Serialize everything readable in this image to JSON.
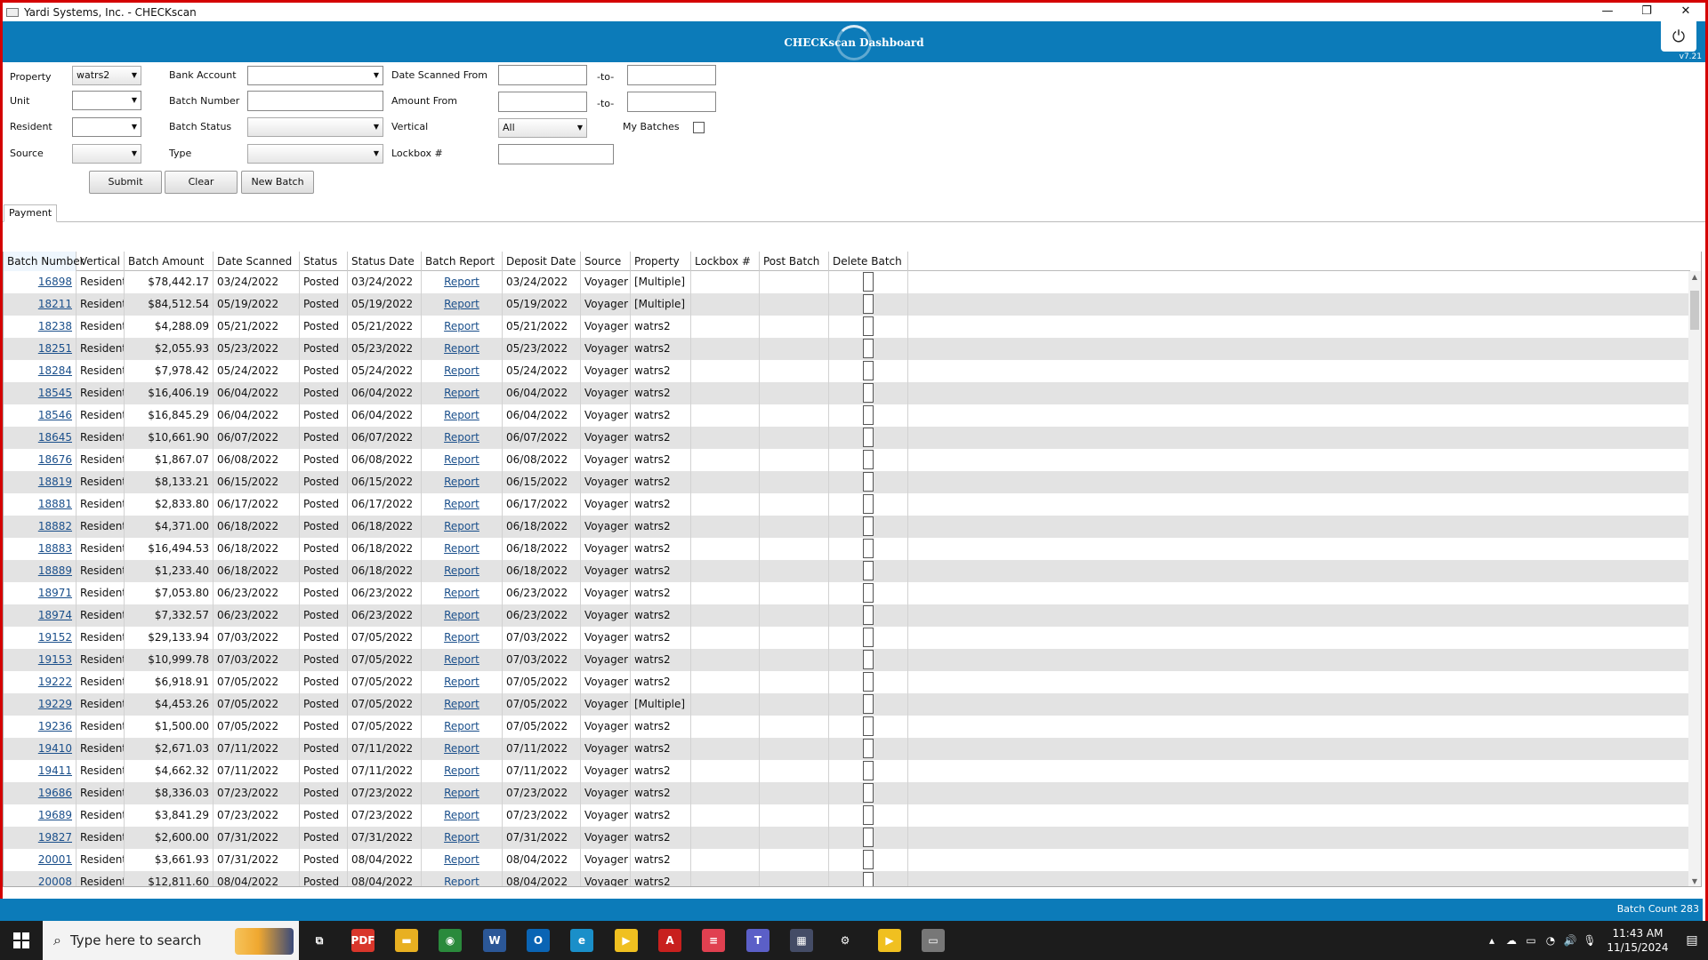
{
  "window": {
    "title": "Yardi Systems, Inc. - CHECKscan",
    "minimize": "—",
    "restore": "❐",
    "close": "✕"
  },
  "header": {
    "title": "CHECKscan Dashboard",
    "version": "v7.21",
    "power_glyph": "⏻"
  },
  "filters": {
    "property_label": "Property",
    "property_value": "watrs2",
    "unit_label": "Unit",
    "resident_label": "Resident",
    "source_label": "Source",
    "bank_account_label": "Bank Account",
    "batch_number_label": "Batch Number",
    "batch_status_label": "Batch Status",
    "type_label": "Type",
    "date_scanned_from_label": "Date Scanned From",
    "amount_from_label": "Amount From",
    "vertical_label": "Vertical",
    "vertical_value": "All",
    "lockbox_label": "Lockbox #",
    "to_label_1": "-to-",
    "to_label_2": "-to-",
    "my_batches_label": "My Batches",
    "submit_label": "Submit",
    "clear_label": "Clear",
    "new_batch_label": "New Batch"
  },
  "tabs": {
    "payment": "Payment"
  },
  "grid": {
    "columns": [
      "Batch Number",
      "Vertical",
      "Batch Amount",
      "Date Scanned",
      "Status",
      "Status Date",
      "Batch Report",
      "Deposit Date",
      "Source",
      "Property",
      "Lockbox #",
      "Post Batch",
      "Delete Batch"
    ],
    "rows": [
      [
        "16898",
        "Residential",
        "$78,442.17",
        "03/24/2022",
        "Posted",
        "03/24/2022",
        "Report",
        "03/24/2022",
        "Voyager",
        "[Multiple]"
      ],
      [
        "18211",
        "Residential",
        "$84,512.54",
        "05/19/2022",
        "Posted",
        "05/19/2022",
        "Report",
        "05/19/2022",
        "Voyager",
        "[Multiple]"
      ],
      [
        "18238",
        "Residential",
        "$4,288.09",
        "05/21/2022",
        "Posted",
        "05/21/2022",
        "Report",
        "05/21/2022",
        "Voyager",
        "watrs2"
      ],
      [
        "18251",
        "Residential",
        "$2,055.93",
        "05/23/2022",
        "Posted",
        "05/23/2022",
        "Report",
        "05/23/2022",
        "Voyager",
        "watrs2"
      ],
      [
        "18284",
        "Residential",
        "$7,978.42",
        "05/24/2022",
        "Posted",
        "05/24/2022",
        "Report",
        "05/24/2022",
        "Voyager",
        "watrs2"
      ],
      [
        "18545",
        "Residential",
        "$16,406.19",
        "06/04/2022",
        "Posted",
        "06/04/2022",
        "Report",
        "06/04/2022",
        "Voyager",
        "watrs2"
      ],
      [
        "18546",
        "Residential",
        "$16,845.29",
        "06/04/2022",
        "Posted",
        "06/04/2022",
        "Report",
        "06/04/2022",
        "Voyager",
        "watrs2"
      ],
      [
        "18645",
        "Residential",
        "$10,661.90",
        "06/07/2022",
        "Posted",
        "06/07/2022",
        "Report",
        "06/07/2022",
        "Voyager",
        "watrs2"
      ],
      [
        "18676",
        "Residential",
        "$1,867.07",
        "06/08/2022",
        "Posted",
        "06/08/2022",
        "Report",
        "06/08/2022",
        "Voyager",
        "watrs2"
      ],
      [
        "18819",
        "Residential",
        "$8,133.21",
        "06/15/2022",
        "Posted",
        "06/15/2022",
        "Report",
        "06/15/2022",
        "Voyager",
        "watrs2"
      ],
      [
        "18881",
        "Residential",
        "$2,833.80",
        "06/17/2022",
        "Posted",
        "06/17/2022",
        "Report",
        "06/17/2022",
        "Voyager",
        "watrs2"
      ],
      [
        "18882",
        "Residential",
        "$4,371.00",
        "06/18/2022",
        "Posted",
        "06/18/2022",
        "Report",
        "06/18/2022",
        "Voyager",
        "watrs2"
      ],
      [
        "18883",
        "Residential",
        "$16,494.53",
        "06/18/2022",
        "Posted",
        "06/18/2022",
        "Report",
        "06/18/2022",
        "Voyager",
        "watrs2"
      ],
      [
        "18889",
        "Residential",
        "$1,233.40",
        "06/18/2022",
        "Posted",
        "06/18/2022",
        "Report",
        "06/18/2022",
        "Voyager",
        "watrs2"
      ],
      [
        "18971",
        "Residential",
        "$7,053.80",
        "06/23/2022",
        "Posted",
        "06/23/2022",
        "Report",
        "06/23/2022",
        "Voyager",
        "watrs2"
      ],
      [
        "18974",
        "Residential",
        "$7,332.57",
        "06/23/2022",
        "Posted",
        "06/23/2022",
        "Report",
        "06/23/2022",
        "Voyager",
        "watrs2"
      ],
      [
        "19152",
        "Residential",
        "$29,133.94",
        "07/03/2022",
        "Posted",
        "07/05/2022",
        "Report",
        "07/03/2022",
        "Voyager",
        "watrs2"
      ],
      [
        "19153",
        "Residential",
        "$10,999.78",
        "07/03/2022",
        "Posted",
        "07/05/2022",
        "Report",
        "07/03/2022",
        "Voyager",
        "watrs2"
      ],
      [
        "19222",
        "Residential",
        "$6,918.91",
        "07/05/2022",
        "Posted",
        "07/05/2022",
        "Report",
        "07/05/2022",
        "Voyager",
        "watrs2"
      ],
      [
        "19229",
        "Residential",
        "$4,453.26",
        "07/05/2022",
        "Posted",
        "07/05/2022",
        "Report",
        "07/05/2022",
        "Voyager",
        "[Multiple]"
      ],
      [
        "19236",
        "Residential",
        "$1,500.00",
        "07/05/2022",
        "Posted",
        "07/05/2022",
        "Report",
        "07/05/2022",
        "Voyager",
        "watrs2"
      ],
      [
        "19410",
        "Residential",
        "$2,671.03",
        "07/11/2022",
        "Posted",
        "07/11/2022",
        "Report",
        "07/11/2022",
        "Voyager",
        "watrs2"
      ],
      [
        "19411",
        "Residential",
        "$4,662.32",
        "07/11/2022",
        "Posted",
        "07/11/2022",
        "Report",
        "07/11/2022",
        "Voyager",
        "watrs2"
      ],
      [
        "19686",
        "Residential",
        "$8,336.03",
        "07/23/2022",
        "Posted",
        "07/23/2022",
        "Report",
        "07/23/2022",
        "Voyager",
        "watrs2"
      ],
      [
        "19689",
        "Residential",
        "$3,841.29",
        "07/23/2022",
        "Posted",
        "07/23/2022",
        "Report",
        "07/23/2022",
        "Voyager",
        "watrs2"
      ],
      [
        "19827",
        "Residential",
        "$2,600.00",
        "07/31/2022",
        "Posted",
        "07/31/2022",
        "Report",
        "07/31/2022",
        "Voyager",
        "watrs2"
      ],
      [
        "20001",
        "Residential",
        "$3,661.93",
        "07/31/2022",
        "Posted",
        "08/04/2022",
        "Report",
        "08/04/2022",
        "Voyager",
        "watrs2"
      ],
      [
        "20008",
        "Residential",
        "$12,811.60",
        "08/04/2022",
        "Posted",
        "08/04/2022",
        "Report",
        "08/04/2022",
        "Voyager",
        "watrs2"
      ]
    ]
  },
  "status_bar": {
    "batch_count": "Batch Count 283"
  },
  "taskbar": {
    "search_placeholder": "Type here to search",
    "time": "11:43 AM",
    "date": "11/15/2024",
    "icons": [
      {
        "name": "task-view-icon",
        "glyph": "⧉",
        "bg": "#1c1c1c"
      },
      {
        "name": "pdf-app-icon",
        "glyph": "PDF",
        "bg": "#d9362b"
      },
      {
        "name": "file-explorer-icon",
        "glyph": "▬",
        "bg": "#e8b021"
      },
      {
        "name": "chrome-icon",
        "glyph": "◉",
        "bg": "#2a8a3c"
      },
      {
        "name": "word-icon",
        "glyph": "W",
        "bg": "#2b5797"
      },
      {
        "name": "outlook-icon",
        "glyph": "O",
        "bg": "#0a64b4"
      },
      {
        "name": "edge-icon",
        "glyph": "e",
        "bg": "#1a8fc9"
      },
      {
        "name": "yellow-app-icon",
        "glyph": "▶",
        "bg": "#f0c020"
      },
      {
        "name": "acrobat-icon",
        "glyph": "A",
        "bg": "#c8201e"
      },
      {
        "name": "red-app-icon",
        "glyph": "≡",
        "bg": "#e04050"
      },
      {
        "name": "teams-icon",
        "glyph": "T",
        "bg": "#5b5fc7"
      },
      {
        "name": "calculator-icon",
        "glyph": "▦",
        "bg": "#444c66"
      },
      {
        "name": "settings-icon",
        "glyph": "⚙",
        "bg": "#1c1c1c"
      },
      {
        "name": "yellow-app-2-icon",
        "glyph": "▶",
        "bg": "#f0c020"
      },
      {
        "name": "checkscan-app-icon",
        "glyph": "▭",
        "bg": "#777"
      }
    ],
    "tray_icons": [
      "▴",
      "☁",
      "▭",
      "◔",
      "🔊",
      "🎙"
    ]
  }
}
